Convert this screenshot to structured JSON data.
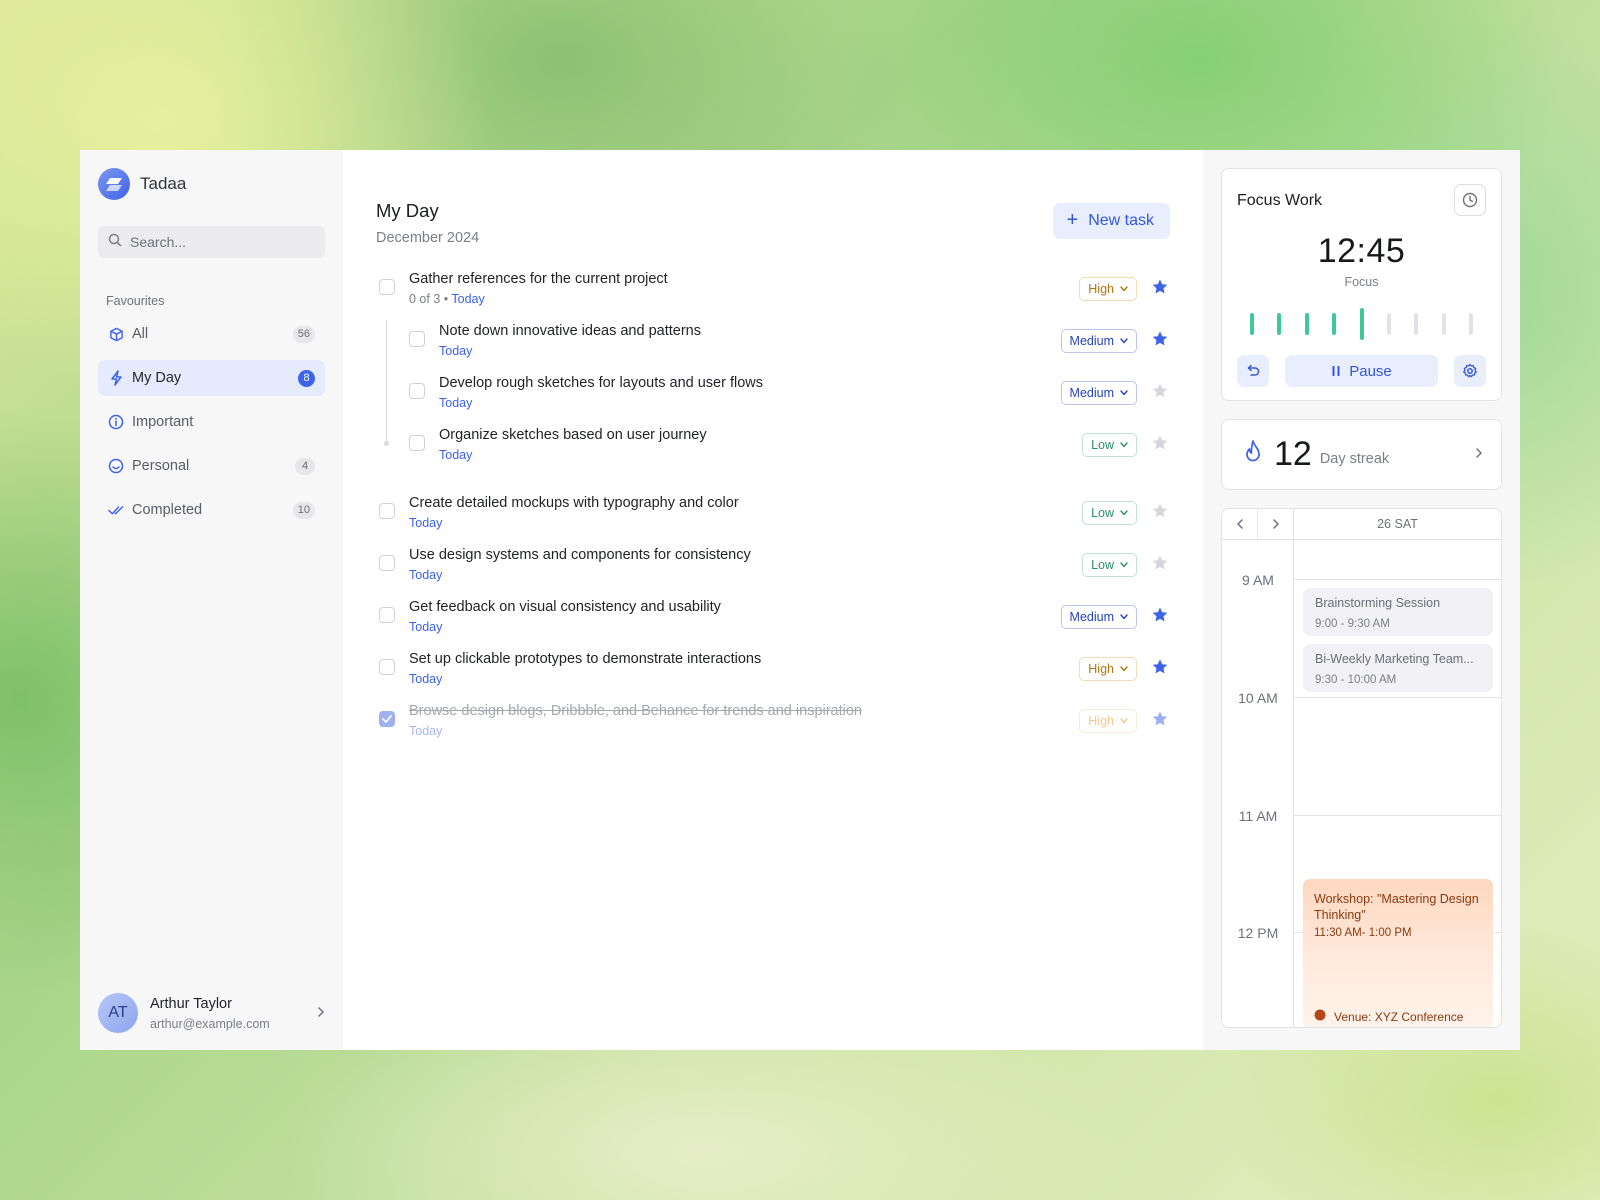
{
  "app": {
    "name": "Tadaa"
  },
  "search": {
    "placeholder": "Search..."
  },
  "sidebar": {
    "section": "Favourites",
    "items": [
      {
        "label": "All",
        "count": "56"
      },
      {
        "label": "My Day",
        "count": "8"
      },
      {
        "label": "Important",
        "count": ""
      },
      {
        "label": "Personal",
        "count": "4"
      },
      {
        "label": "Completed",
        "count": "10"
      }
    ]
  },
  "user": {
    "initials": "AT",
    "name": "Arthur Taylor",
    "email": "arthur@example.com"
  },
  "main": {
    "title": "My Day",
    "subtitle": "December 2024",
    "new_task_label": "New task",
    "tasks": [
      {
        "title": "Gather references for the current project",
        "progress": "0 of 3",
        "sep": "•",
        "due": "Today",
        "priority": "High",
        "starred": true
      },
      {
        "title": "Note down innovative ideas and patterns",
        "due": "Today",
        "priority": "Medium",
        "starred": true
      },
      {
        "title": "Develop rough sketches for layouts and user flows",
        "due": "Today",
        "priority": "Medium",
        "starred": false
      },
      {
        "title": "Organize sketches based on user journey",
        "due": "Today",
        "priority": "Low",
        "starred": false
      },
      {
        "title": "Create detailed mockups with typography and color",
        "due": "Today",
        "priority": "Low",
        "starred": false
      },
      {
        "title": "Use design systems and components for consistency",
        "due": "Today",
        "priority": "Low",
        "starred": false
      },
      {
        "title": "Get feedback on visual consistency and usability",
        "due": "Today",
        "priority": "Medium",
        "starred": true
      },
      {
        "title": "Set up clickable prototypes to demonstrate interactions",
        "due": "Today",
        "priority": "High",
        "starred": true
      },
      {
        "title": "Browse design blogs, Dribbble, and Behance for trends and inspiration",
        "due": "Today",
        "priority": "High",
        "starred": true,
        "completed": true
      }
    ]
  },
  "focus": {
    "title": "Focus Work",
    "time": "12:45",
    "mode": "Focus",
    "pause_label": "Pause",
    "sessions_done": 5,
    "sessions_total": 9
  },
  "streak": {
    "count": "12",
    "label": "Day streak"
  },
  "calendar": {
    "day": "26 SAT",
    "hours": [
      "9 AM",
      "10 AM",
      "11 AM",
      "12 PM"
    ],
    "events": [
      {
        "name": "Brainstorming Session",
        "time": "9:00 - 9:30 AM"
      },
      {
        "name": "Bi-Weekly Marketing Team...",
        "time": "9:30 - 10:00 AM"
      },
      {
        "name": "Workshop: \"Mastering Design Thinking\"",
        "time": "11:30 AM- 1:00 PM",
        "venue": "Venue: XYZ Conference"
      }
    ]
  },
  "colors": {
    "accent": "#3d63e8",
    "focus_green": "#3ec99a",
    "star_on": "#3d63e8",
    "star_off": "#d6d7db",
    "high": "#b07513",
    "medium": "#2745b6",
    "low": "#2b8f6b"
  }
}
